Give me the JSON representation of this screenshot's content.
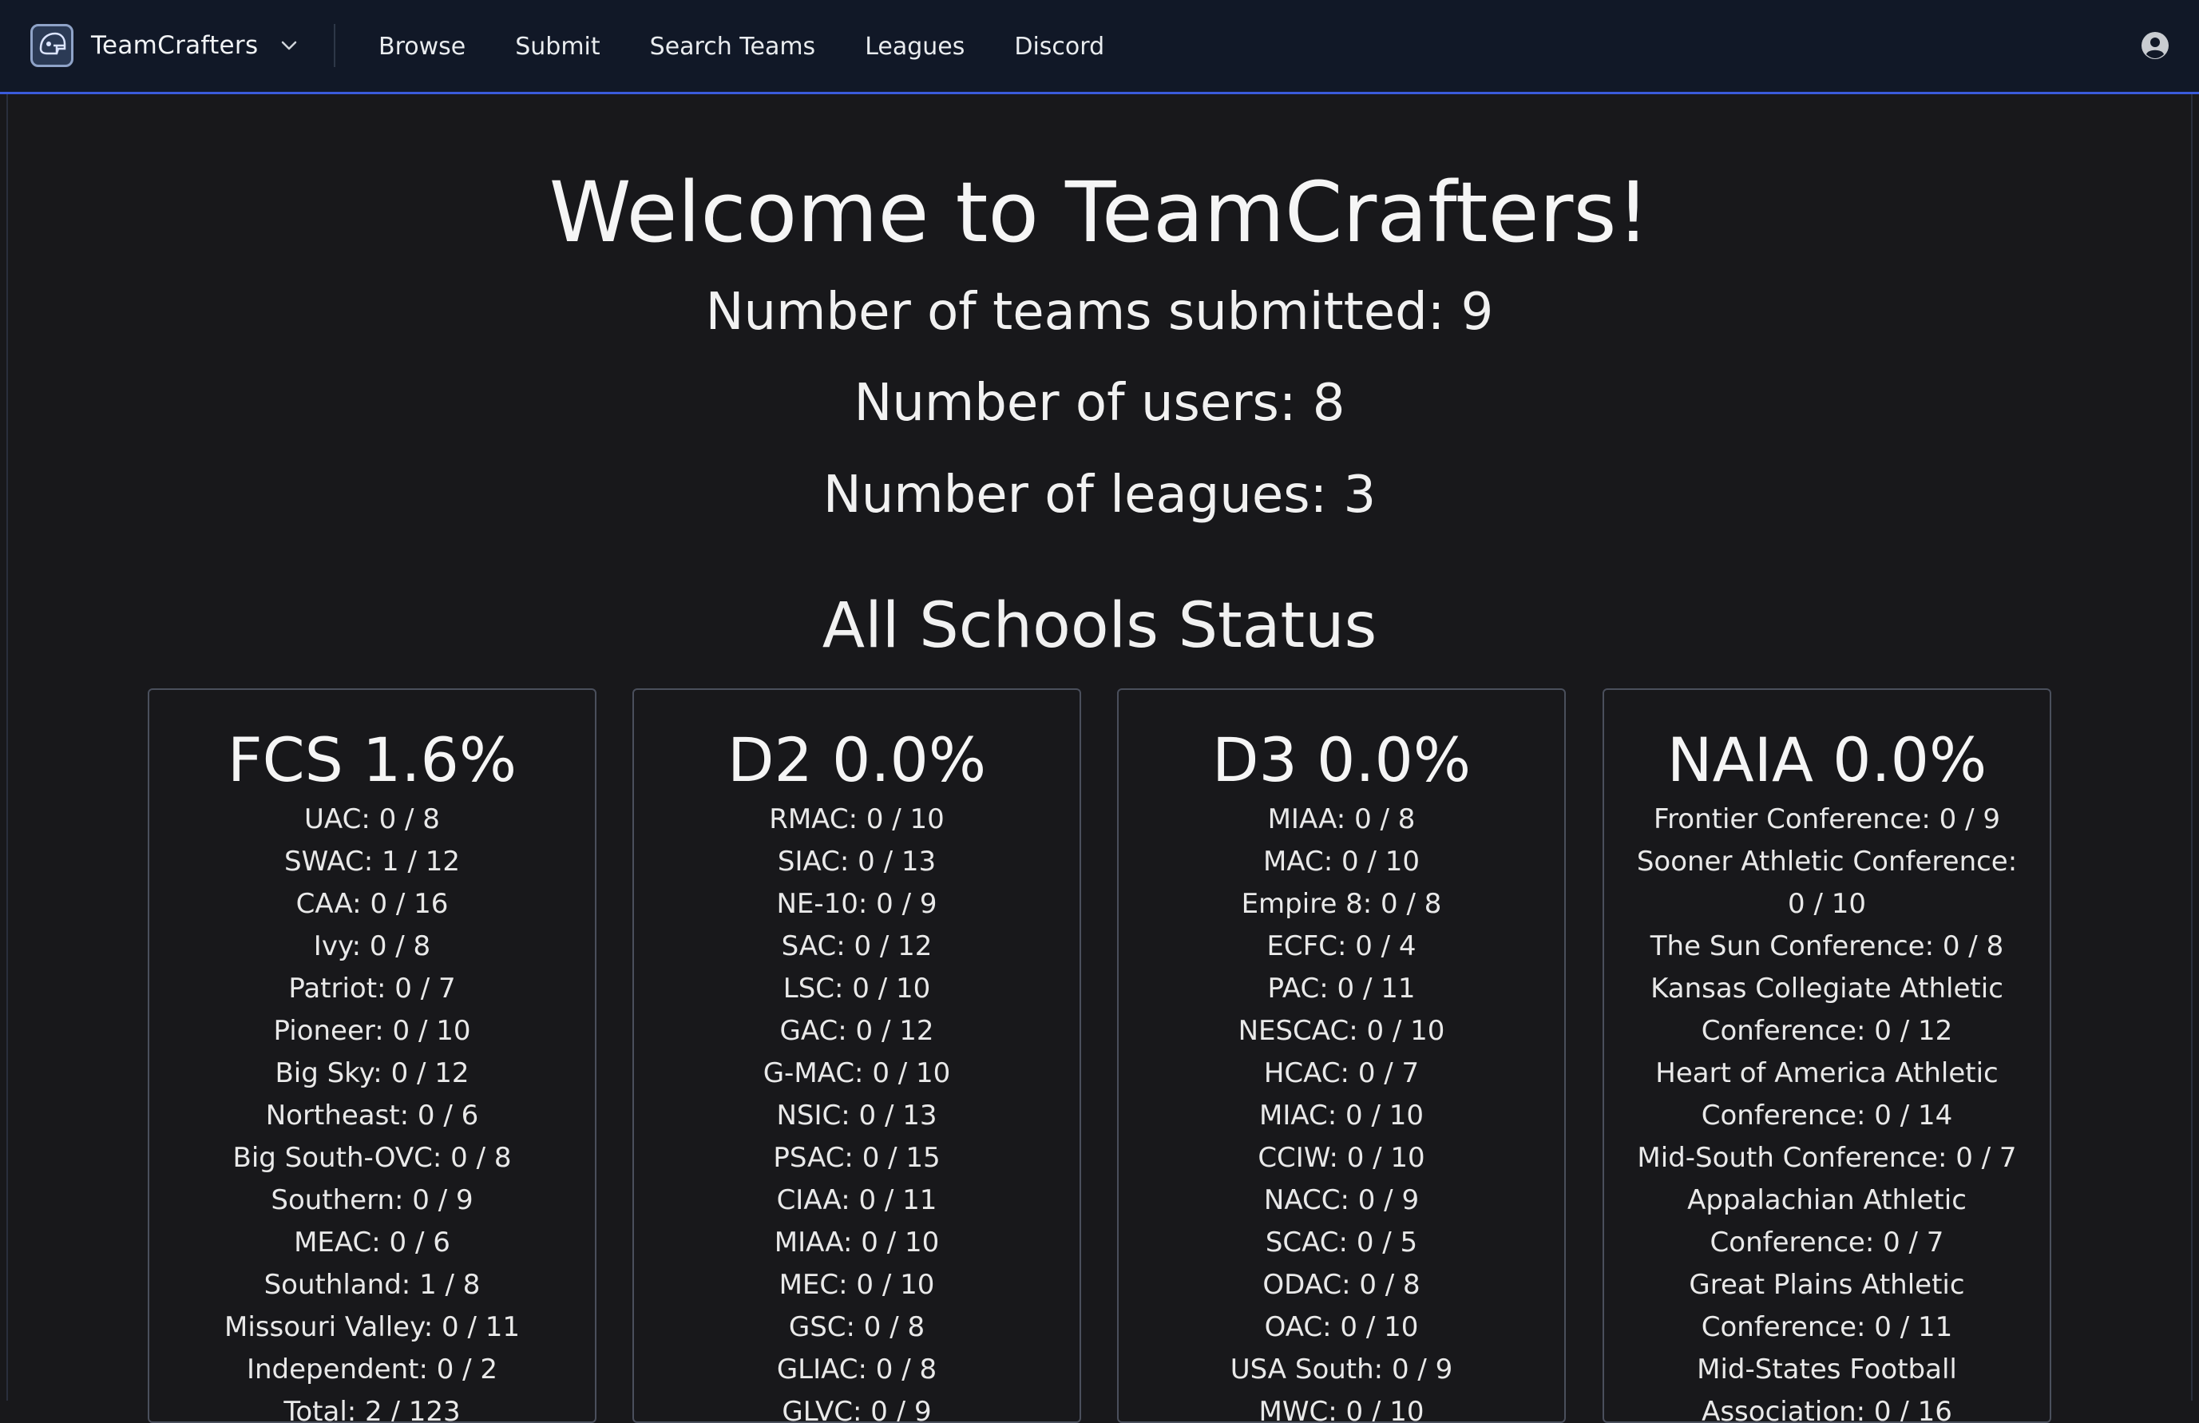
{
  "navbar": {
    "brand_name": "TeamCrafters",
    "links": [
      "Browse",
      "Submit",
      "Search Teams",
      "Leagues",
      "Discord"
    ]
  },
  "hero": {
    "title": "Welcome to TeamCrafters!",
    "stats": [
      "Number of teams submitted: 9",
      "Number of users: 8",
      "Number of leagues: 3"
    ]
  },
  "schools": {
    "title": "All Schools Status",
    "cards": [
      {
        "title": "FCS 1.6%",
        "items": [
          "UAC: 0 / 8",
          "SWAC: 1 / 12",
          "CAA: 0 / 16",
          "Ivy: 0 / 8",
          "Patriot: 0 / 7",
          "Pioneer: 0 / 10",
          "Big Sky: 0 / 12",
          "Northeast: 0 / 6",
          "Big South-OVC: 0 / 8",
          "Southern: 0 / 9",
          "MEAC: 0 / 6",
          "Southland: 1 / 8",
          "Missouri Valley: 0 / 11",
          "Independent: 0 / 2",
          "Total: 2 / 123"
        ]
      },
      {
        "title": "D2 0.0%",
        "items": [
          "RMAC: 0 / 10",
          "SIAC: 0 / 13",
          "NE-10: 0 / 9",
          "SAC: 0 / 12",
          "LSC: 0 / 10",
          "GAC: 0 / 12",
          "G-MAC: 0 / 10",
          "NSIC: 0 / 13",
          "PSAC: 0 / 15",
          "CIAA: 0 / 11",
          "MIAA: 0 / 10",
          "MEC: 0 / 10",
          "GSC: 0 / 8",
          "GLIAC: 0 / 8",
          "GLVC: 0 / 9"
        ]
      },
      {
        "title": "D3 0.0%",
        "items": [
          "MIAA: 0 / 8",
          "MAC: 0 / 10",
          "Empire 8: 0 / 8",
          "ECFC: 0 / 4",
          "PAC: 0 / 11",
          "NESCAC: 0 / 10",
          "HCAC: 0 / 7",
          "MIAC: 0 / 10",
          "CCIW: 0 / 10",
          "NACC: 0 / 9",
          "SCAC: 0 / 5",
          "ODAC: 0 / 8",
          "OAC: 0 / 10",
          "USA South: 0 / 9",
          "MWC: 0 / 10"
        ]
      },
      {
        "title": "NAIA 0.0%",
        "items": [
          "Frontier Conference: 0 / 9",
          "Sooner Athletic Conference: 0 / 10",
          "The Sun Conference: 0 / 8",
          "Kansas Collegiate Athletic Conference: 0 / 12",
          "Heart of America Athletic Conference: 0 / 14",
          "Mid-South Conference: 0 / 7",
          "Appalachian Athletic Conference: 0 / 7",
          "Great Plains Athletic Conference: 0 / 11",
          "Mid-States Football Association: 0 / 16"
        ]
      }
    ]
  }
}
